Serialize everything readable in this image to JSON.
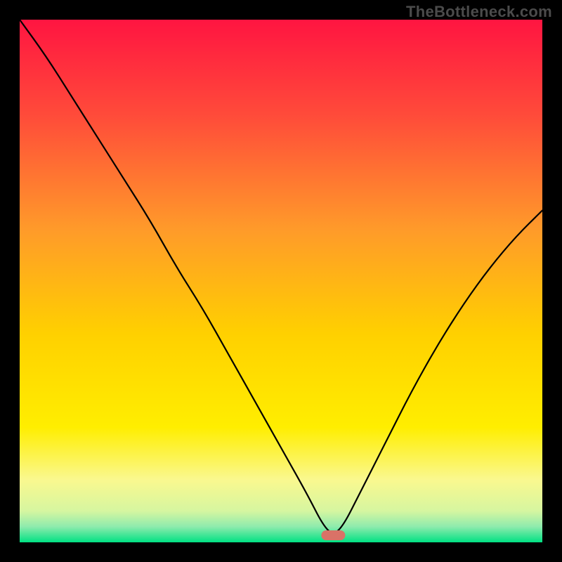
{
  "watermark": "TheBottleneck.com",
  "colors": {
    "bg": "#000000",
    "grad_top": "#ff1541",
    "grad_mid1": "#ff8a2a",
    "grad_mid2": "#ffe300",
    "grad_low": "#fbf99a",
    "grad_bottom": "#00e183",
    "curve": "#000000",
    "marker": "#d97267"
  },
  "chart_data": {
    "type": "line",
    "title": "",
    "xlabel": "",
    "ylabel": "",
    "xlim": [
      0,
      100
    ],
    "ylim": [
      0,
      100
    ],
    "x": [
      0,
      5,
      10,
      15,
      20,
      25,
      30,
      35,
      40,
      45,
      50,
      55,
      58,
      60,
      62,
      65,
      70,
      75,
      80,
      85,
      90,
      95,
      100
    ],
    "values": [
      100,
      93,
      85,
      77,
      69,
      61,
      52,
      44,
      35,
      26,
      17,
      8,
      2,
      0,
      2,
      8,
      18,
      28,
      37,
      45,
      52,
      58,
      63
    ],
    "marker_x": 60,
    "annotations": []
  }
}
